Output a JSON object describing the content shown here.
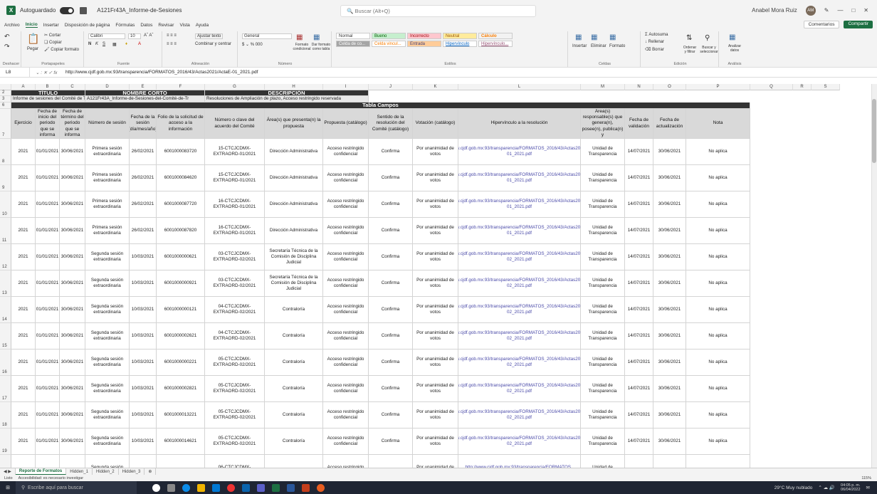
{
  "titlebar": {
    "autosave": "Autoguardado",
    "filename": "A121Fr43A_Informe-de-Sesiones",
    "search_placeholder": "Buscar (Alt+Q)",
    "user": "Anabel Mora Ruiz",
    "initials": "AM"
  },
  "menu": [
    "Archivo",
    "Inicio",
    "Insertar",
    "Disposición de página",
    "Fórmulas",
    "Datos",
    "Revisar",
    "Vista",
    "Ayuda"
  ],
  "menu_active": "Inicio",
  "comments": "Comentarios",
  "share": "Compartir",
  "ribbon": {
    "undo": "Deshacer",
    "paste": "Pegar",
    "cut": "Cortar",
    "copy": "Copiar",
    "copy_format": "Copiar formato",
    "clipboard": "Portapapeles",
    "font": "Calibri",
    "size": "10",
    "font_group": "Fuente",
    "wrap": "Ajustar texto",
    "merge": "Combinar y centrar",
    "align_group": "Alineación",
    "numfmt": "General",
    "number_group": "Número",
    "cond_format": "Formato condicional",
    "table_format": "Dar formato como tabla",
    "styles_group": "Estilos",
    "styles": [
      "Normal",
      "Bueno",
      "Incorrecto",
      "Neutral",
      "Cálculo",
      "Celda de co...",
      "Celda vincul...",
      "Entrada",
      "Hipervínculo",
      "Hipervínculo..."
    ],
    "insert": "Insertar",
    "delete": "Eliminar",
    "format": "Formato",
    "cells_group": "Celdas",
    "autosum": "Autosuma",
    "fill": "Rellenar",
    "clear": "Borrar",
    "sort": "Ordenar y filtrar",
    "find": "Buscar y seleccionar",
    "edit_group": "Edición",
    "analyze": "Analizar datos",
    "analysis_group": "Análisis"
  },
  "formula": {
    "cell": "L8",
    "value": "http://www.cjdf.gob.mx:93/transparencia/FORMATOS_2016/43/Actas2021/ActaE-01_2021.pdf"
  },
  "columns": [
    "A",
    "B",
    "C",
    "D",
    "E",
    "F",
    "G",
    "H",
    "I",
    "J",
    "K",
    "L",
    "M",
    "N",
    "O",
    "P",
    "Q",
    "R",
    "S"
  ],
  "meta_row": {
    "titulo": "TÍTULO",
    "nombre_corto": "NOMBRE CORTO",
    "descripcion": "DESCRIPCIÓN",
    "titulo_val": "Informe de sesiones del Comité de Tr",
    "nombre_val": "A121Fr43A_Informe-de-Sesiones-del-Comité-de-Tr",
    "desc_val": "Resoluciones de Ampliación de plazo, Acceso restringido reservada",
    "tabla": "Tabla Campos"
  },
  "headers": [
    "Ejercicio",
    "Fecha de inicio del periodo que se informa",
    "Fecha de término del periodo que se informa",
    "Número de sesión",
    "Fecha de la sesión (día/mes/año)",
    "Folio de la solicitud de acceso a la información",
    "Número o clave del acuerdo del Comité",
    "Área(s) que presenta(n) la propuesta",
    "Propuesta (catálogo)",
    "Sentido de la resolución del Comité (catálogo)",
    "Votación (catálogo)",
    "Hipervínculo a la resolución",
    "Área(s) responsable(s) que genera(n), posee(n), publica(n) y",
    "Fecha de validación",
    "Fecha de actualización",
    "Nota"
  ],
  "rows": [
    [
      "2021",
      "01/01/2021",
      "30/06/2021",
      "Primera sesión extraordinaria",
      "26/02/2021",
      "6001000083720",
      "15-CTCJCDMX-EXTRAORD-01/2021",
      "Dirección Administrativa",
      "Acceso restringido confidencial",
      "Confirma",
      "Por unanimidad de votos",
      "http://www.cjdf.gob.mx:93/transparencia/FORMATOS_2016/43/Actas2021/ActaE-01_2021.pdf",
      "Unidad de Transparencia",
      "14/07/2021",
      "30/06/2021",
      "No aplica"
    ],
    [
      "2021",
      "01/01/2021",
      "30/06/2021",
      "Primera sesión extraordinaria",
      "26/02/2021",
      "6001000084620",
      "15-CTCJCDMX-EXTRAORD-01/2021",
      "Dirección Administrativa",
      "Acceso restringido confidencial",
      "Confirma",
      "Por unanimidad de votos",
      "http://www.cjdf.gob.mx:93/transparencia/FORMATOS_2016/43/Actas2021/ActaE-01_2021.pdf",
      "Unidad de Transparencia",
      "14/07/2021",
      "30/06/2021",
      "No aplica"
    ],
    [
      "2021",
      "01/01/2021",
      "30/06/2021",
      "Primera sesión extraordinaria",
      "26/02/2021",
      "6001000087720",
      "16-CTCJCDMX-EXTRAORD-01/2021",
      "Dirección Administrativa",
      "Acceso restringido confidencial",
      "Confirma",
      "Por unanimidad de votos",
      "http://www.cjdf.gob.mx:93/transparencia/FORMATOS_2016/43/Actas2021/ActaE-01_2021.pdf",
      "Unidad de Transparencia",
      "14/07/2021",
      "30/06/2021",
      "No aplica"
    ],
    [
      "2021",
      "01/01/2021",
      "30/06/2021",
      "Primera sesión extraordinaria",
      "26/02/2021",
      "6001000087820",
      "16-CTCJCDMX-EXTRAORD-01/2021",
      "Dirección Administrativa",
      "Acceso restringido confidencial",
      "Confirma",
      "Por unanimidad de votos",
      "http://www.cjdf.gob.mx:93/transparencia/FORMATOS_2016/43/Actas2021/ActaE-01_2021.pdf",
      "Unidad de Transparencia",
      "14/07/2021",
      "30/06/2021",
      "No aplica"
    ],
    [
      "2021",
      "01/01/2021",
      "30/06/2021",
      "Segunda sesión extraordinaria",
      "10/03/2021",
      "6001000000621",
      "03-CTCJCDMX-EXTRAORD-02/2021",
      "Secretaría Técnica de la Comisión de Disciplina Judicial",
      "Acceso restringido confidencial",
      "Confirma",
      "Por unanimidad de votos",
      "http://www.cjdf.gob.mx:93/transparencia/FORMATOS_2016/43/Actas2021/ActaE-02_2021.pdf",
      "Unidad de Transparencia",
      "14/07/2021",
      "30/06/2021",
      "No aplica"
    ],
    [
      "2021",
      "01/01/2021",
      "30/06/2021",
      "Segunda sesión extraordinaria",
      "10/03/2021",
      "6001000000921",
      "03-CTCJCDMX-EXTRAORD-02/2021",
      "Secretaría Técnica de la Comisión de Disciplina Judicial",
      "Acceso restringido confidencial",
      "Confirma",
      "Por unanimidad de votos",
      "http://www.cjdf.gob.mx:93/transparencia/FORMATOS_2016/43/Actas2021/ActaE-02_2021.pdf",
      "Unidad de Transparencia",
      "14/07/2021",
      "30/06/2021",
      "No aplica"
    ],
    [
      "2021",
      "01/01/2021",
      "30/06/2021",
      "Segunda sesión extraordinaria",
      "10/03/2021",
      "6001000000121",
      "04-CTCJCDMX-EXTRAORD-02/2021",
      "Contraloría",
      "Acceso restringido confidencial",
      "Confirma",
      "Por unanimidad de votos",
      "http://www.cjdf.gob.mx:93/transparencia/FORMATOS_2016/43/Actas2021/ActaE-02_2021.pdf",
      "Unidad de Transparencia",
      "14/07/2021",
      "30/06/2021",
      "No aplica"
    ],
    [
      "2021",
      "01/01/2021",
      "30/06/2021",
      "Segunda sesión extraordinaria",
      "10/03/2021",
      "6001000002621",
      "04-CTCJCDMX-EXTRAORD-02/2021",
      "Contraloría",
      "Acceso restringido confidencial",
      "Confirma",
      "Por unanimidad de votos",
      "http://www.cjdf.gob.mx:93/transparencia/FORMATOS_2016/43/Actas2021/ActaE-02_2021.pdf",
      "Unidad de Transparencia",
      "14/07/2021",
      "30/06/2021",
      "No aplica"
    ],
    [
      "2021",
      "01/01/2021",
      "30/06/2021",
      "Segunda sesión extraordinaria",
      "10/03/2021",
      "6001000000221",
      "05-CTCJCDMX-EXTRAORD-02/2021",
      "Contraloría",
      "Acceso restringido confidencial",
      "Confirma",
      "Por unanimidad de votos",
      "http://www.cjdf.gob.mx:93/transparencia/FORMATOS_2016/43/Actas2021/ActaE-02_2021.pdf",
      "Unidad de Transparencia",
      "14/07/2021",
      "30/06/2021",
      "No aplica"
    ],
    [
      "2021",
      "01/01/2021",
      "30/06/2021",
      "Segunda sesión extraordinaria",
      "10/03/2021",
      "6001000002821",
      "05-CTCJCDMX-EXTRAORD-02/2021",
      "Contraloría",
      "Acceso restringido confidencial",
      "Confirma",
      "Por unanimidad de votos",
      "http://www.cjdf.gob.mx:93/transparencia/FORMATOS_2016/43/Actas2021/ActaE-02_2021.pdf",
      "Unidad de Transparencia",
      "14/07/2021",
      "30/06/2021",
      "No aplica"
    ],
    [
      "2021",
      "01/01/2021",
      "30/06/2021",
      "Segunda sesión extraordinaria",
      "10/03/2021",
      "6001000013221",
      "05-CTCJCDMX-EXTRAORD-02/2021",
      "Contraloría",
      "Acceso restringido confidencial",
      "Confirma",
      "Por unanimidad de votos",
      "http://www.cjdf.gob.mx:93/transparencia/FORMATOS_2016/43/Actas2021/ActaE-02_2021.pdf",
      "Unidad de Transparencia",
      "14/07/2021",
      "30/06/2021",
      "No aplica"
    ],
    [
      "2021",
      "01/01/2021",
      "30/06/2021",
      "Segunda sesión extraordinaria",
      "10/03/2021",
      "6001000014621",
      "05-CTCJCDMX-EXTRAORD-02/2021",
      "Contraloría",
      "Acceso restringido confidencial",
      "Confirma",
      "Por unanimidad de votos",
      "http://www.cjdf.gob.mx:93/transparencia/FORMATOS_2016/43/Actas2021/ActaE-02_2021.pdf",
      "Unidad de Transparencia",
      "14/07/2021",
      "30/06/2021",
      "No aplica"
    ],
    [
      "",
      "",
      "",
      "Segunda sesión",
      "",
      "",
      "06-CTCJCDMX-",
      "",
      "Acceso restringido",
      "",
      "Por unanimidad de",
      "http://www.cjdf.gob.mx:93/transparencia/FORMATOS_",
      "Unidad de",
      "",
      "",
      ""
    ]
  ],
  "row_numbers": [
    "8",
    "9",
    "10",
    "11",
    "12",
    "13",
    "14",
    "15",
    "16",
    "17",
    "18",
    "19",
    "20"
  ],
  "sheets": [
    "Reporte de Formatos",
    "Hidden_1",
    "Hidden_2",
    "Hidden_3"
  ],
  "status": {
    "ready": "Listo",
    "accessibility": "Accesibilidad: es necesario investigar",
    "zoom": "115%"
  },
  "taskbar": {
    "search": "Escribe aquí para buscar",
    "weather": "29°C Muy nublado",
    "time": "04:05 p. m.",
    "date": "06/04/2022"
  }
}
